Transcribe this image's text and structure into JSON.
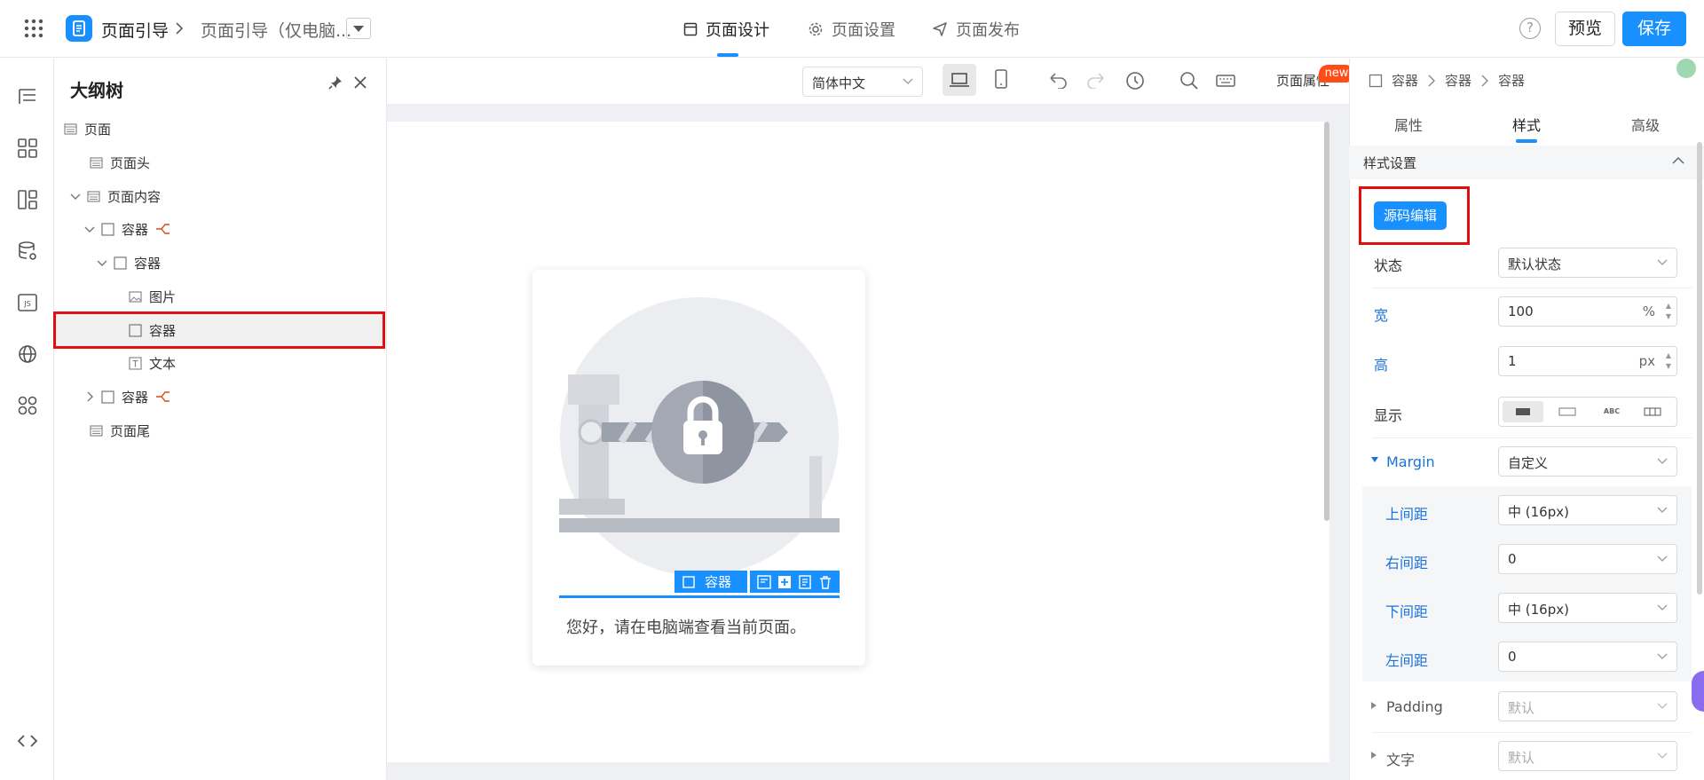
{
  "topbar": {
    "app_title": "页面引导",
    "page_name": "页面引导（仅电脑...",
    "tabs": [
      {
        "label": "页面设计",
        "active": true
      },
      {
        "label": "页面设置",
        "active": false
      },
      {
        "label": "页面发布",
        "active": false
      }
    ],
    "help": "?",
    "preview_label": "预览",
    "save_label": "保存"
  },
  "rail": {
    "items": [
      "outline-icon",
      "components-icon",
      "layout-icon",
      "datasource-icon",
      "js-icon",
      "globe-icon",
      "apps-icon",
      "code-icon"
    ],
    "js_label": "JS"
  },
  "outline": {
    "title": "大纲树",
    "nodes": [
      {
        "label": "页面",
        "icon": "page-icon",
        "level": 0
      },
      {
        "label": "页面头",
        "icon": "page-icon",
        "level": 1
      },
      {
        "label": "页面内容",
        "icon": "page-icon",
        "level": 1,
        "expanded": true
      },
      {
        "label": "容器",
        "icon": "container-icon",
        "level": 2,
        "expanded": true,
        "linked": true
      },
      {
        "label": "容器",
        "icon": "container-icon",
        "level": 3,
        "expanded": true
      },
      {
        "label": "图片",
        "icon": "image-icon",
        "level": 4
      },
      {
        "label": "容器",
        "icon": "container-icon",
        "level": 4,
        "selected": true
      },
      {
        "label": "文本",
        "icon": "text-icon",
        "level": 4
      },
      {
        "label": "容器",
        "icon": "container-icon",
        "level": 2,
        "expanded": false,
        "linked": true
      },
      {
        "label": "页面尾",
        "icon": "page-icon",
        "level": 1
      }
    ]
  },
  "canvas_toolbar": {
    "language": "简体中文",
    "page_props_label": "页面属性",
    "new_badge": "new"
  },
  "canvas": {
    "card_text": "您好，请在电脑端查看当前页面。",
    "selected_tag": "容器"
  },
  "right_panel": {
    "breadcrumb": [
      "容器",
      "容器",
      "容器"
    ],
    "tabs": [
      {
        "label": "属性",
        "active": false
      },
      {
        "label": "样式",
        "active": true
      },
      {
        "label": "高级",
        "active": false
      }
    ],
    "section_title": "样式设置",
    "source_edit_label": "源码编辑",
    "fields": {
      "state": {
        "label": "状态",
        "value": "默认状态"
      },
      "width": {
        "label": "宽",
        "value": "100",
        "unit": "%"
      },
      "height": {
        "label": "高",
        "value": "1",
        "unit": "px"
      },
      "display": {
        "label": "显示",
        "options": [
          "ABC",
          "ABC"
        ]
      },
      "margin": {
        "label": "Margin",
        "value": "自定义"
      },
      "margin_top": {
        "label": "上间距",
        "value": "中 (16px)"
      },
      "margin_right": {
        "label": "右间距",
        "value": "0"
      },
      "margin_bottom": {
        "label": "下间距",
        "value": "中 (16px)"
      },
      "margin_left": {
        "label": "左间距",
        "value": "0"
      },
      "padding": {
        "label": "Padding",
        "value": "默认"
      },
      "text": {
        "label": "文字",
        "value": "默认"
      }
    }
  },
  "colors": {
    "accent": "#1890ff",
    "highlight_border": "#e01010",
    "badge": "#ff4d1a"
  }
}
